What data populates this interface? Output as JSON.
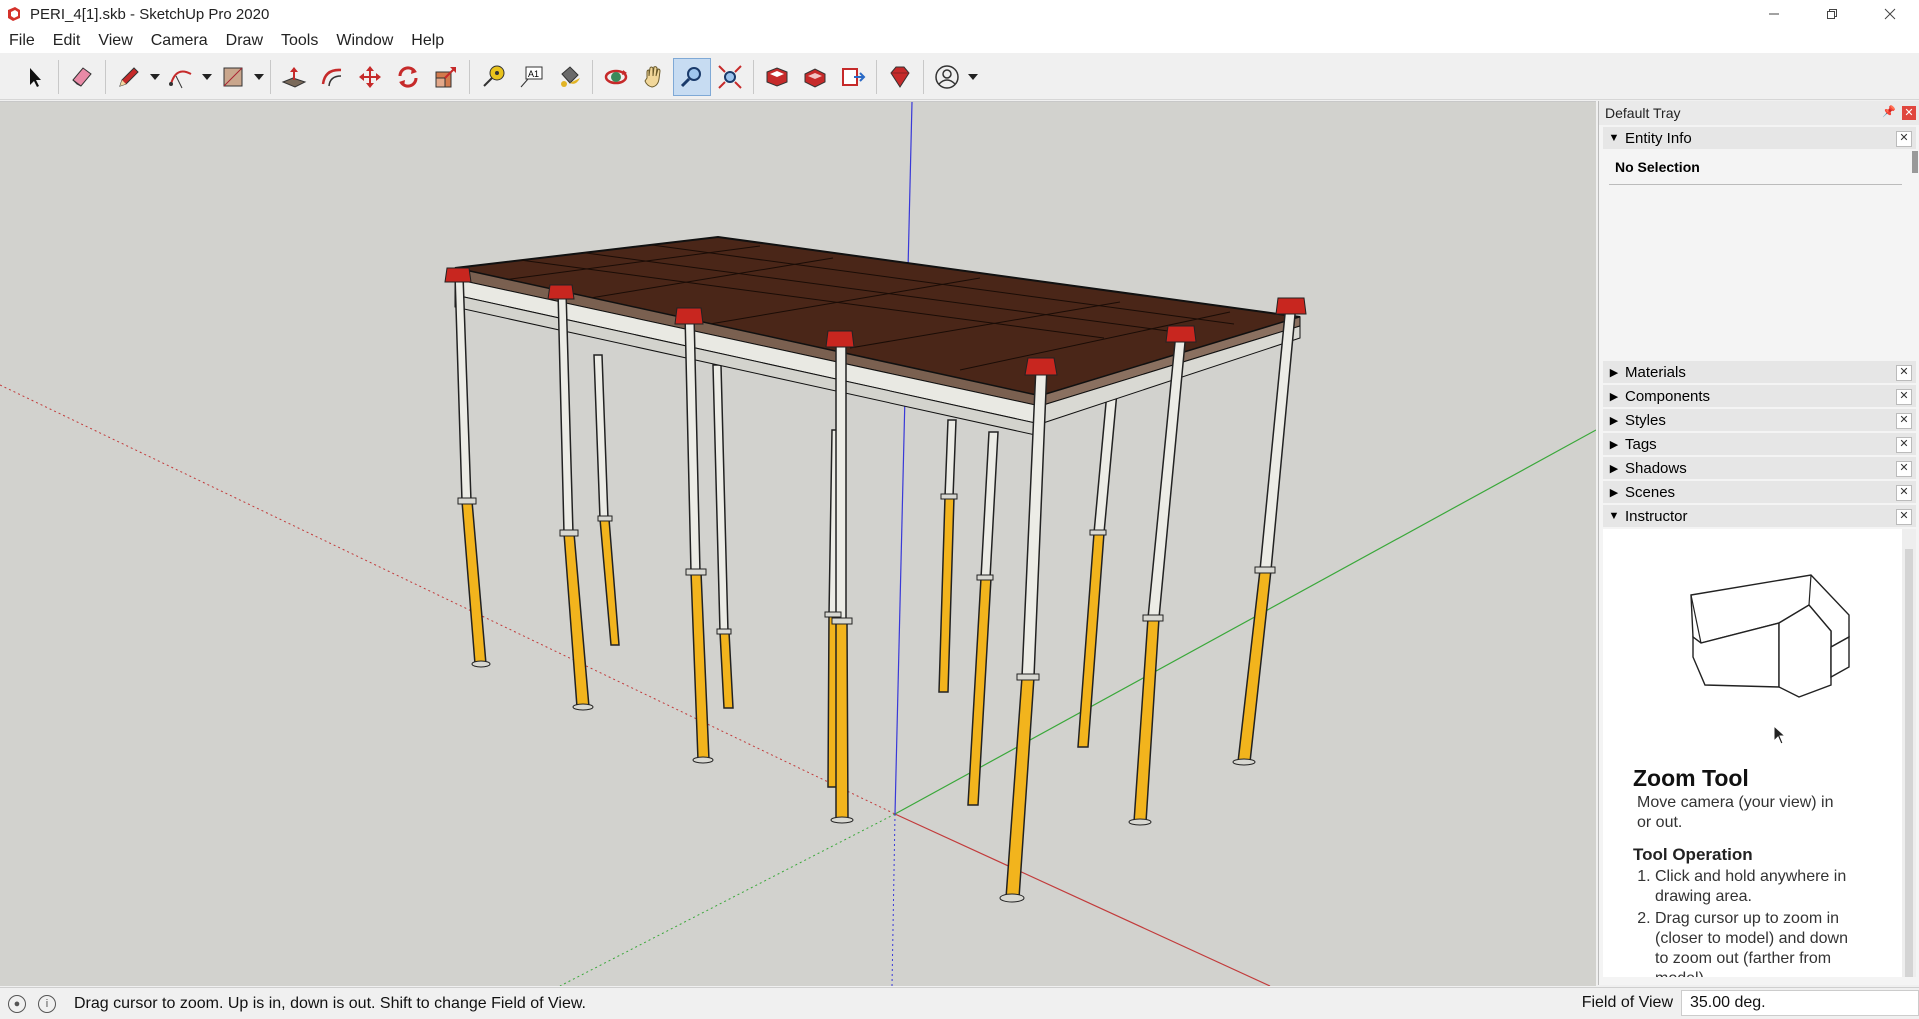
{
  "window": {
    "title": "PERI_4[1].skb - SketchUp Pro 2020"
  },
  "menu": [
    "File",
    "Edit",
    "View",
    "Camera",
    "Draw",
    "Tools",
    "Window",
    "Help"
  ],
  "toolbar": {
    "tools": [
      "select",
      "eraser",
      "line",
      "arc",
      "rectangle",
      "push-pull",
      "offset",
      "move",
      "rotate",
      "scale",
      "tape-measure",
      "text",
      "paint-bucket",
      "orbit",
      "pan",
      "zoom",
      "zoom-extents",
      "3d-warehouse",
      "extension-warehouse",
      "send-to-layout",
      "extension-manager",
      "account"
    ],
    "active_tool": "zoom"
  },
  "tray": {
    "title": "Default Tray",
    "entity_info": {
      "label": "Entity Info",
      "selection": "No Selection"
    },
    "panels": [
      "Materials",
      "Components",
      "Styles",
      "Tags",
      "Shadows",
      "Scenes"
    ],
    "instructor": {
      "label": "Instructor",
      "tool_title": "Zoom Tool",
      "tool_desc": "Move camera (your view) in or out.",
      "operation_title": "Tool Operation",
      "steps": [
        "Click and hold anywhere in drawing area.",
        "Drag cursor up to zoom in (closer to model) and down to zoom out (farther from model)."
      ]
    }
  },
  "status": {
    "message": "Drag cursor to zoom.  Up is in, down is out. Shift to change Field of View.",
    "measure_label": "Field of View",
    "measure_value": "35.00 deg."
  },
  "colors": {
    "accent": "#c7dcf2",
    "deck": "#4a2618",
    "prop_bottom": "#f1b51c",
    "prop_top": "#e9e9e3",
    "clamp": "#c8261f"
  }
}
